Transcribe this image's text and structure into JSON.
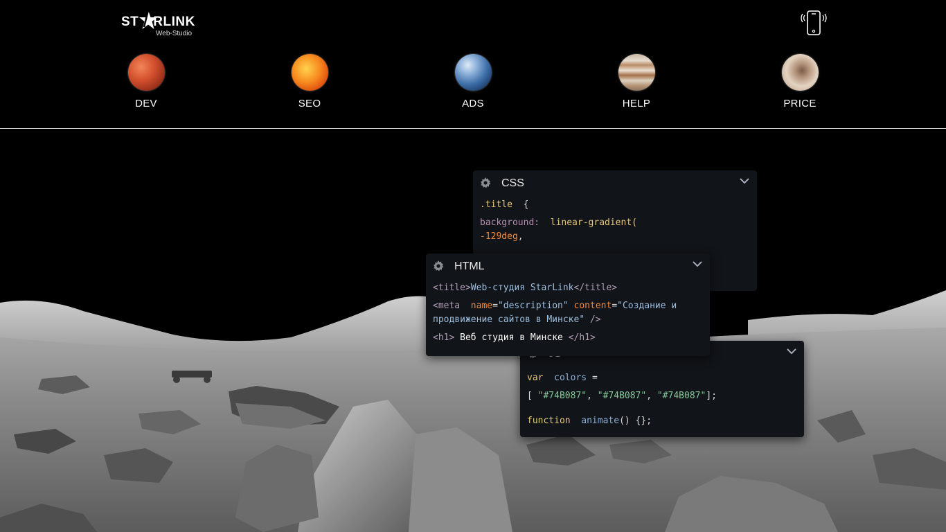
{
  "logo": {
    "text_left": "ST",
    "text_right": "RLINK",
    "subtitle": "Web-Studio"
  },
  "icons": {
    "phone": "phone-vibrate-icon",
    "gear": "gear-icon",
    "chevron": "chevron-down-icon"
  },
  "nav": [
    {
      "label": "DEV",
      "planet": "mars"
    },
    {
      "label": "SEO",
      "planet": "sun"
    },
    {
      "label": "ADS",
      "planet": "earth"
    },
    {
      "label": "HELP",
      "planet": "jupiter"
    },
    {
      "label": "PRICE",
      "planet": "moon"
    }
  ],
  "css_panel": {
    "title": "CSS",
    "selector": ".title",
    "brace_open": "{",
    "property": "background:",
    "function": "linear-gradient(",
    "value": "-129deg",
    "comma": ","
  },
  "html_panel": {
    "title": "HTML",
    "line1_open": "<title>",
    "line1_text": "Web-студия StarLink",
    "line1_close": "</title>",
    "line2_tag": "<meta",
    "line2_attr1": "name",
    "line2_eq1": "=",
    "line2_val1": "\"description\"",
    "line2_attr2": "content",
    "line2_eq2": "=",
    "line2_val2": "\"Создание и продвижение сайтов в Минске\"",
    "line2_close": "/>",
    "line3_open": "<h1>",
    "line3_text": "Веб студия в Минске",
    "line3_close": "</h1>"
  },
  "js_panel": {
    "title": "JS",
    "keyword_var": "var",
    "var_name": "colors",
    "equals": "=",
    "bracket_open": "[",
    "color1": "\"#74B087\"",
    "color2": "\"#74B087\"",
    "color3": "\"#74B087\"",
    "sep": ",",
    "bracket_close": "];",
    "keyword_function": "function",
    "function_name": "animate",
    "function_tail": "() {};"
  }
}
